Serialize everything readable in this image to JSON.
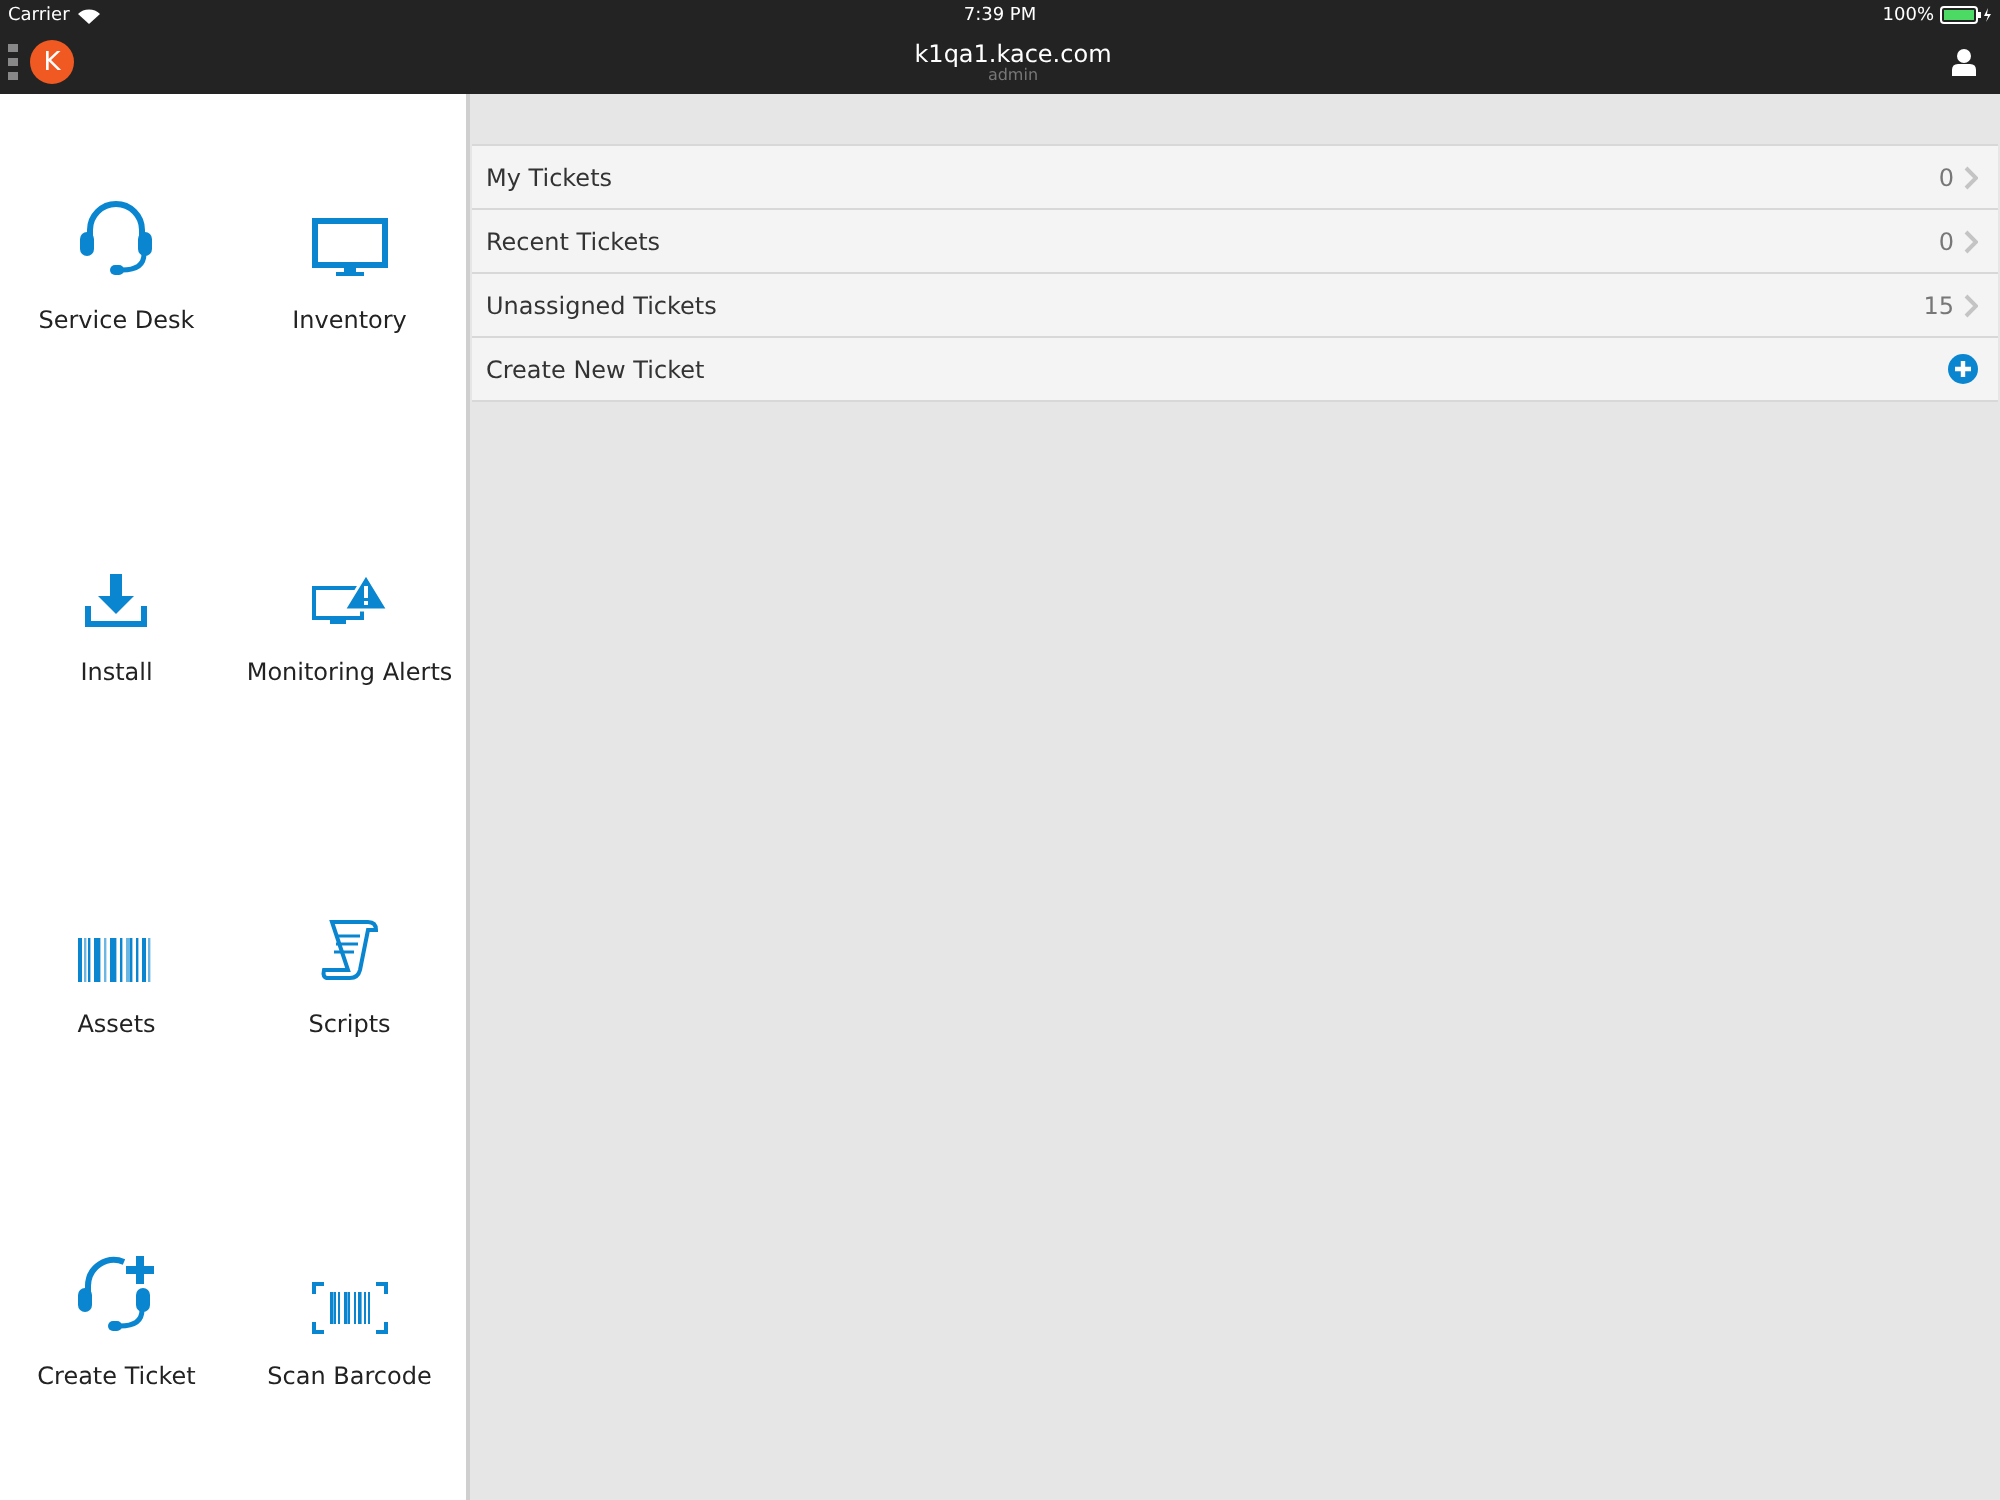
{
  "status_bar": {
    "carrier": "Carrier",
    "time": "7:39 PM",
    "battery": "100%"
  },
  "nav_bar": {
    "logo": "K",
    "title": "k1qa1.kace.com",
    "subtitle": "admin"
  },
  "sidebar": {
    "tiles": [
      {
        "label": "Service Desk",
        "kind": "headset"
      },
      {
        "label": "Inventory",
        "kind": "monitor"
      },
      {
        "label": "Install",
        "kind": "download"
      },
      {
        "label": "Monitoring Alerts",
        "kind": "alert"
      },
      {
        "label": "Assets",
        "kind": "barcode"
      },
      {
        "label": "Scripts",
        "kind": "scroll"
      },
      {
        "label": "Create Ticket",
        "kind": "headsetplus"
      },
      {
        "label": "Scan Barcode",
        "kind": "scan"
      }
    ]
  },
  "list": {
    "rows": [
      {
        "label": "My Tickets",
        "kind": "count",
        "count": "0"
      },
      {
        "label": "Recent Tickets",
        "kind": "count",
        "count": "0"
      },
      {
        "label": "Unassigned Tickets",
        "kind": "count",
        "count": "15"
      },
      {
        "label": "Create New Ticket",
        "kind": "add"
      }
    ]
  }
}
